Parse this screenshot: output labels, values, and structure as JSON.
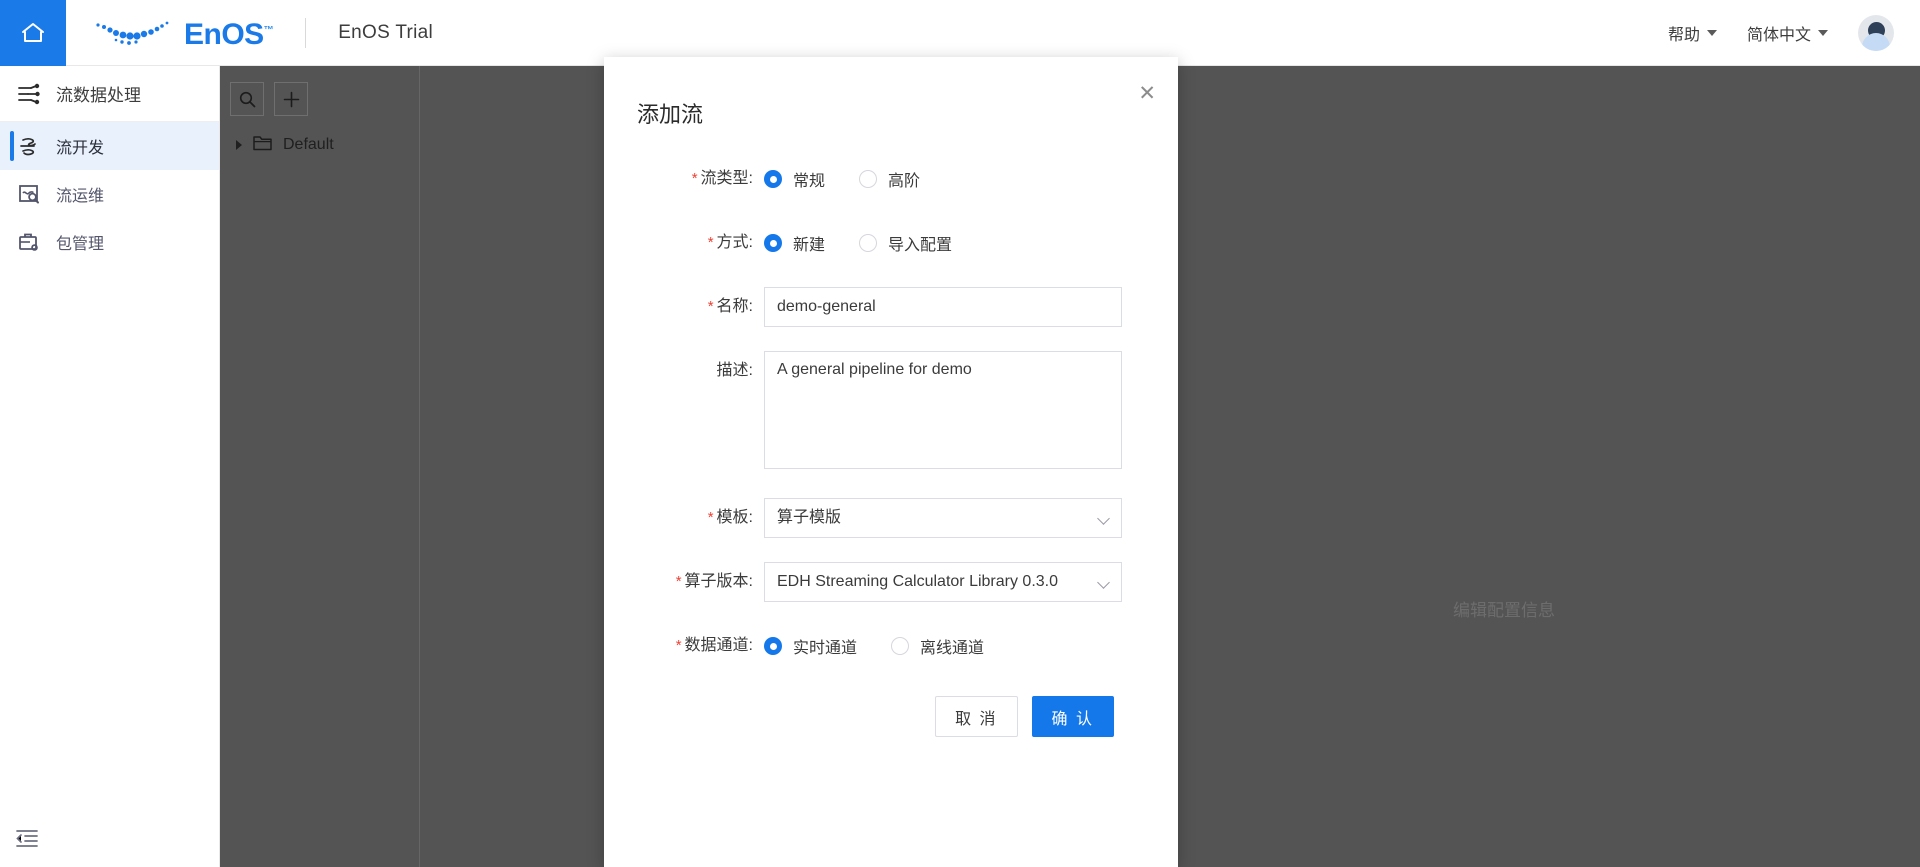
{
  "header": {
    "home_icon": "home-icon",
    "brand": "EnOS",
    "brand_tm": "™",
    "app_title": "EnOS Trial",
    "help_label": "帮助",
    "language_label": "简体中文",
    "avatar": "user-avatar"
  },
  "sidebar": {
    "section_title": "流数据处理",
    "section_icon": "stream-data-icon",
    "items": [
      {
        "label": "流开发",
        "icon": "stream-dev-icon",
        "active": true
      },
      {
        "label": "流运维",
        "icon": "stream-ops-icon",
        "active": false
      },
      {
        "label": "包管理",
        "icon": "package-manage-icon",
        "active": false
      }
    ],
    "collapse_icon": "collapse-sidebar-icon"
  },
  "workspace": {
    "search_icon": "search-icon",
    "add_icon": "plus-icon",
    "tree": [
      {
        "label": "Default",
        "icon": "folder-icon",
        "expanded": false
      }
    ],
    "background_hint": "编辑配置信息"
  },
  "dialog": {
    "title": "添加流",
    "close_icon": "close-icon",
    "fields": {
      "flow_type": {
        "label": "流类型",
        "required": true,
        "options": [
          {
            "label": "常规",
            "selected": true
          },
          {
            "label": "高阶",
            "selected": false
          }
        ]
      },
      "method": {
        "label": "方式",
        "required": true,
        "options": [
          {
            "label": "新建",
            "selected": true
          },
          {
            "label": "导入配置",
            "selected": false
          }
        ]
      },
      "name": {
        "label": "名称",
        "required": true,
        "value": "demo-general",
        "placeholder": ""
      },
      "description": {
        "label": "描述",
        "required": false,
        "value": "A general pipeline for demo",
        "placeholder": ""
      },
      "template": {
        "label": "模板",
        "required": true,
        "value": "算子模版",
        "chevron": "chevron-down-icon"
      },
      "operator_version": {
        "label": "算子版本",
        "required": true,
        "value": "EDH Streaming Calculator Library 0.3.0",
        "chevron": "chevron-down-icon"
      },
      "data_channel": {
        "label": "数据通道",
        "required": true,
        "options": [
          {
            "label": "实时通道",
            "selected": true
          },
          {
            "label": "离线通道",
            "selected": false
          }
        ]
      }
    },
    "buttons": {
      "cancel": "取 消",
      "confirm": "确 认"
    }
  },
  "colors": {
    "accent": "#1477ea",
    "home_tile": "#1a7ae8",
    "required_star": "#f04134",
    "dim_backdrop": "#545454",
    "active_item_bg": "#e9f1fd"
  }
}
